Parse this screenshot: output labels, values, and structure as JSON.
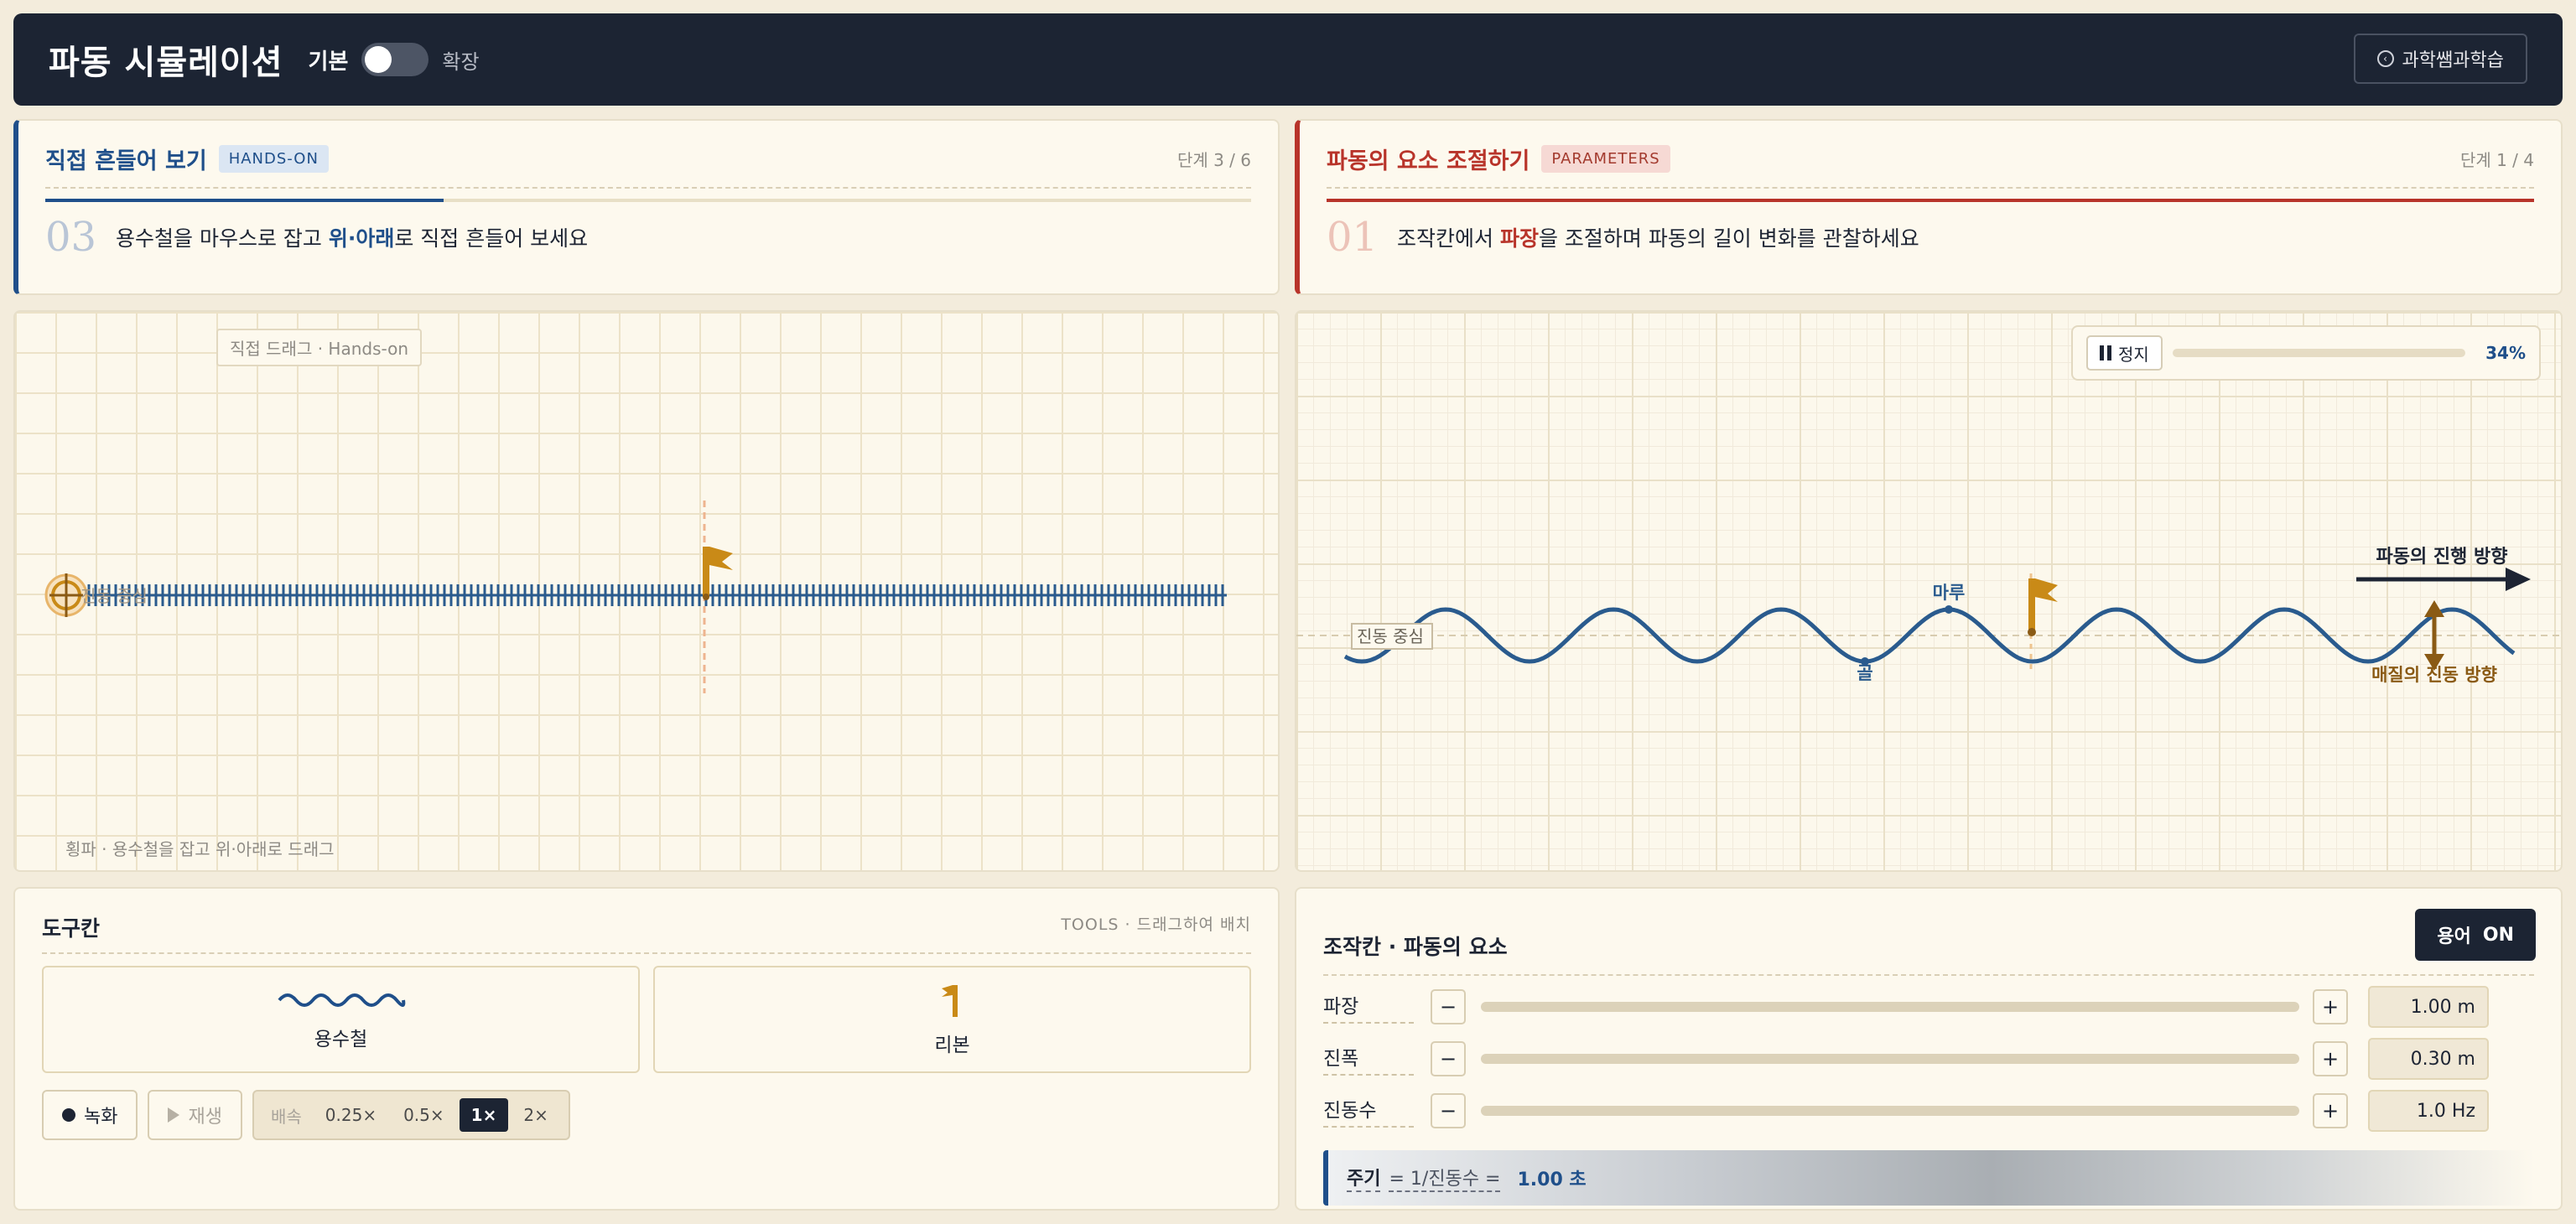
{
  "header": {
    "title": "파동 시뮬레이션",
    "mode_basic": "기본",
    "mode_extended": "확장",
    "back_label": "과학쌤과학습",
    "back_icon": "circle-arrow-left-icon"
  },
  "left_step": {
    "title": "직접 흔들어 보기",
    "badge": "HANDS-ON",
    "counter": "단계 3 / 6",
    "progress": 0.33,
    "number": "03",
    "text_before": "용수철을 마우스로 잡고 ",
    "text_highlight": "위·아래",
    "text_after": "로 직접 흔들어 보세요"
  },
  "right_step": {
    "title": "파동의 요소 조절하기",
    "badge": "PARAMETERS",
    "counter": "단계 1 / 4",
    "progress": 1.0,
    "number": "01",
    "text_before": "조작칸에서 ",
    "text_highlight": "파장",
    "text_after": "을 조절하며 파동의 길이 변화를 관찰하세요"
  },
  "left_canvas": {
    "tag": "직접 드래그 · Hands-on",
    "footer": "횡파 · 용수철을 잡고 위·아래로 드래그",
    "center_label": "진동 중심"
  },
  "right_canvas": {
    "pause_label": "정지",
    "progress_pct": "34%",
    "direction_label": "파동의 진행 방향",
    "crest_label": "마루",
    "trough_label": "골",
    "center_label": "진동 중심",
    "medium_label": "매질의 진동 방향",
    "colors": {
      "wave": "#2a5b8e",
      "medium": "#8a5a14",
      "ribbon": "#c98a17"
    }
  },
  "tools": {
    "title": "도구칸",
    "subtitle": "TOOLS · 드래그하여 배치",
    "items": [
      {
        "label": "용수철",
        "icon": "spring-wave-icon"
      },
      {
        "label": "리본",
        "icon": "ribbon-flag-icon"
      }
    ],
    "record_label": "녹화",
    "play_label": "재생",
    "speed_label": "배속",
    "speeds": [
      "0.25×",
      "0.5×",
      "1×",
      "2×"
    ],
    "speed_active": "1×"
  },
  "controls": {
    "title": "조작칸 · 파동의 요소",
    "term_label": "용어",
    "term_state": "ON",
    "params": [
      {
        "label": "파장",
        "value": "1.00 m"
      },
      {
        "label": "진폭",
        "value": "0.30 m"
      },
      {
        "label": "진동수",
        "value": "1.0 Hz"
      }
    ],
    "period_key": "주기",
    "period_formula": "= 1/진동수 =",
    "period_value": "1.00 초"
  }
}
